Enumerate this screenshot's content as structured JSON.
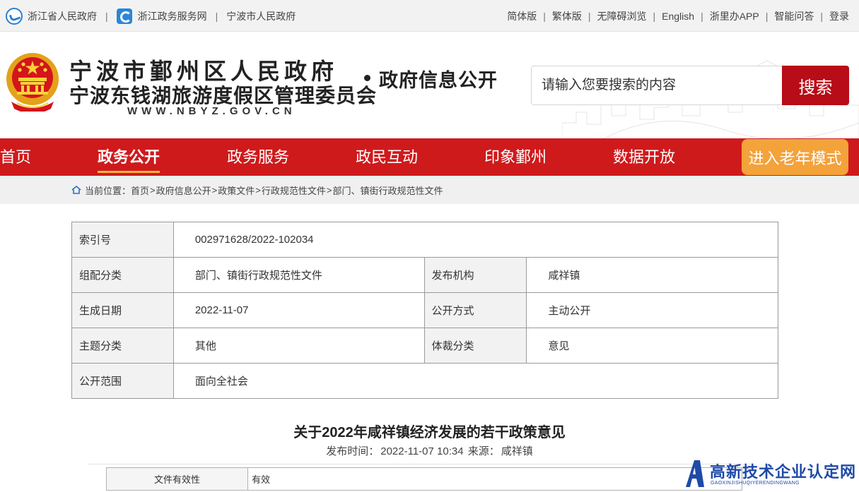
{
  "topbar": {
    "left_links": [
      "浙江省人民政府",
      "浙江政务服务网",
      "宁波市人民政府"
    ],
    "separator": "|",
    "right_links": [
      "简体版",
      "繁体版",
      "无障碍浏览",
      "English",
      "浙里办APP",
      "智能问答",
      "登录"
    ]
  },
  "header": {
    "org_name_1": "宁波市鄞州区人民政府",
    "org_name_2": "宁波东钱湖旅游度假区管理委员会",
    "site_url": "WWW.NBYZ.GOV.CN",
    "section_title": "政府信息公开",
    "emblem_icon": "national-emblem-icon",
    "search": {
      "placeholder": "请输入您要搜索的内容",
      "button_label": "搜索"
    }
  },
  "nav": {
    "items": [
      "首页",
      "政务公开",
      "政务服务",
      "政民互动",
      "印象鄞州",
      "数据开放"
    ],
    "active": "政务公开",
    "elder_mode_label": "进入老年模式",
    "colors": {
      "bar": "#cf1a1c",
      "elder_button": "#f4a23a",
      "active_underline": "#f5b53d"
    }
  },
  "breadcrumb": {
    "label": "当前位置：",
    "items": [
      "首页",
      "政府信息公开",
      "政策文件",
      "行政规范性文件",
      "部门、镇街行政规范性文件"
    ],
    "separator": ">"
  },
  "meta": {
    "index_no": {
      "label": "索引号",
      "value": "002971628/2022-102034"
    },
    "category": {
      "label": "组配分类",
      "value": "部门、镇街行政规范性文件"
    },
    "issuer": {
      "label": "发布机构",
      "value": "咸祥镇"
    },
    "date": {
      "label": "生成日期",
      "value": "2022-11-07"
    },
    "open_method": {
      "label": "公开方式",
      "value": "主动公开"
    },
    "topic": {
      "label": "主题分类",
      "value": "其他"
    },
    "genre": {
      "label": "体裁分类",
      "value": "意见"
    },
    "scope": {
      "label": "公开范围",
      "value": "面向全社会"
    }
  },
  "article": {
    "title": "关于2022年咸祥镇经济发展的若干政策意见",
    "publish_label": "发布时间：",
    "publish_time": "2022-11-07 10:34",
    "source_label": "来源：",
    "source": "咸祥镇",
    "validity": {
      "label": "文件有效性",
      "value": "有效"
    }
  },
  "watermark": {
    "title": "高新技术企业认定网",
    "subtitle": "GAOXINJISHUQIYERENDINGWANG"
  },
  "colors": {
    "brand_red": "#b80c18",
    "table_border": "#9a9a9a",
    "label_bg": "#f2f2f2"
  }
}
